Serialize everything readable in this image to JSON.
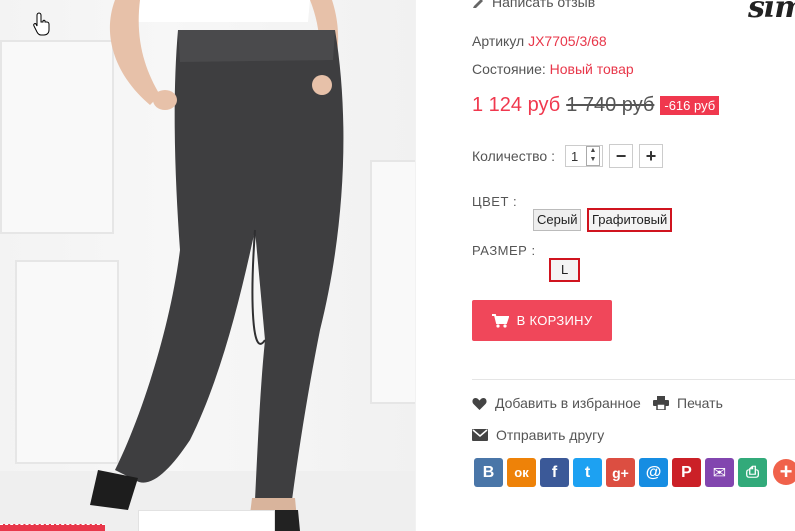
{
  "header": {
    "review_link": "Написать отзыв",
    "brand": "sim"
  },
  "product": {
    "sku_label": "Артикул",
    "sku_value": "JX7705/3/68",
    "condition_label": "Состояние:",
    "condition_value": "Новый товар",
    "price_new": "1 124 руб",
    "price_old": "1 740 руб",
    "discount": "-616 руб"
  },
  "quantity": {
    "label": "Количество :",
    "value": "1",
    "minus": "−",
    "plus": "+"
  },
  "color": {
    "label": "ЦВЕТ :",
    "options": [
      "Серый",
      "Графитовый"
    ],
    "selected": "Графитовый"
  },
  "size": {
    "label": "РАЗМЕР :",
    "options": [
      "L"
    ],
    "selected": "L"
  },
  "cart_button": "В КОРЗИНУ",
  "actions": {
    "wishlist": "Добавить в избранное",
    "print": "Печать",
    "send_friend": "Отправить другу"
  },
  "share": [
    {
      "name": "vk-icon",
      "glyph": "В",
      "color": "#4a76a8"
    },
    {
      "name": "odnoklassniki-icon",
      "glyph": "ок",
      "color": "#ee8208"
    },
    {
      "name": "facebook-icon",
      "glyph": "f",
      "color": "#3b5998"
    },
    {
      "name": "twitter-icon",
      "glyph": "t",
      "color": "#1da1f2"
    },
    {
      "name": "google-plus-icon",
      "glyph": "g+",
      "color": "#dc4e41"
    },
    {
      "name": "mail-ru-icon",
      "glyph": "@",
      "color": "#168de2"
    },
    {
      "name": "pinterest-icon",
      "glyph": "P",
      "color": "#cb2027"
    },
    {
      "name": "email-icon",
      "glyph": "✉",
      "color": "#8246af"
    },
    {
      "name": "print-share-icon",
      "glyph": "⎙",
      "color": "#32aa7a"
    }
  ],
  "colors": {
    "accent": "#f0384e",
    "selected_border": "#d0141f"
  }
}
